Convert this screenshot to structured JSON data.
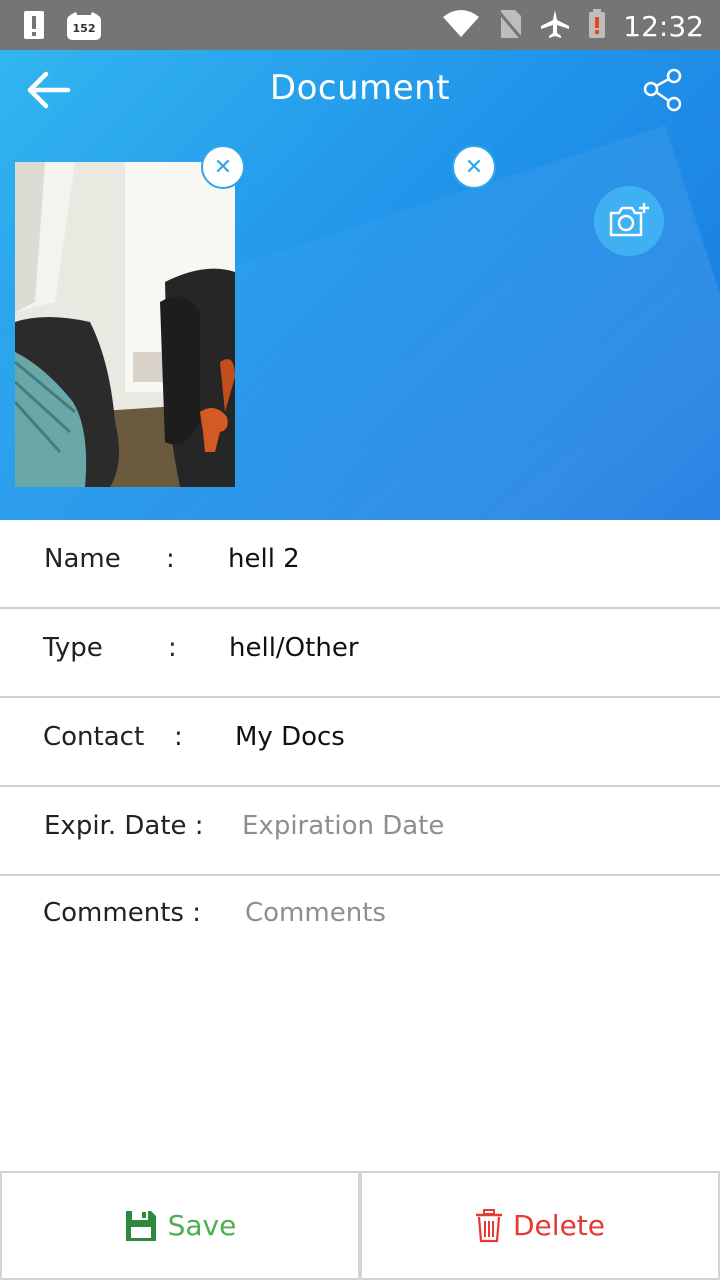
{
  "status_bar": {
    "time": "12:32",
    "notification_badge": "152",
    "icons": [
      "alert-icon",
      "notification-app-icon",
      "wifi-icon",
      "no-sim-icon",
      "airplane-mode-icon",
      "battery-alert-icon"
    ]
  },
  "toolbar": {
    "title": "Document",
    "back_icon": "arrow-left-icon",
    "share_icon": "share-icon"
  },
  "attachments": {
    "remove_icon": "close-icon",
    "add_photo_icon": "camera-add-icon"
  },
  "form": {
    "name_label": "Name",
    "name_colon": ":",
    "name_value": "hell 2",
    "type_label": "Type",
    "type_colon": ":",
    "type_value": "hell/Other",
    "contact_label": "Contact",
    "contact_colon": ":",
    "contact_value": "My Docs",
    "expiry_label": "Expir. Date :",
    "expiry_placeholder": "Expiration Date",
    "comments_label": "Comments :",
    "comments_placeholder": "Comments"
  },
  "actions": {
    "save_label": "Save",
    "delete_label": "Delete",
    "save_color": "#4caf50",
    "delete_color": "#e53935"
  },
  "colors": {
    "header_start": "#33b6f0",
    "header_end": "#1877e0",
    "status_bar": "#757575"
  }
}
